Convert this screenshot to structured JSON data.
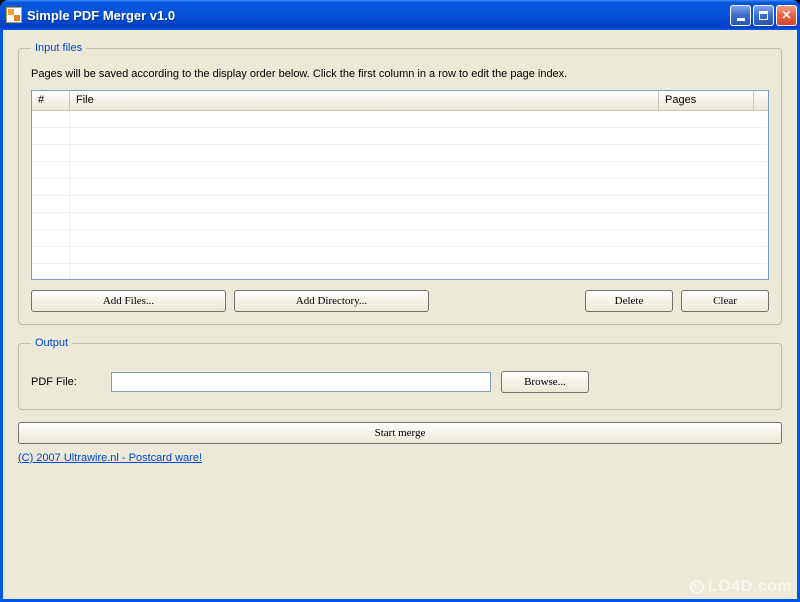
{
  "window": {
    "title": "Simple PDF Merger v1.0"
  },
  "input_group": {
    "legend": "Input files",
    "instruction": "Pages will be saved according to the display order below. Click the first column in a row to edit the page index.",
    "columns": {
      "num": "#",
      "file": "File",
      "pages": "Pages"
    },
    "rows": [],
    "buttons": {
      "add_files": "Add Files...",
      "add_directory": "Add Directory...",
      "delete": "Delete",
      "clear": "Clear"
    }
  },
  "output_group": {
    "legend": "Output",
    "label": "PDF File:",
    "value": "",
    "browse": "Browse..."
  },
  "start_button": "Start merge",
  "footer_link": "(C) 2007 Ultrawire.nl - Postcard ware!",
  "watermark": "LO4D.com"
}
